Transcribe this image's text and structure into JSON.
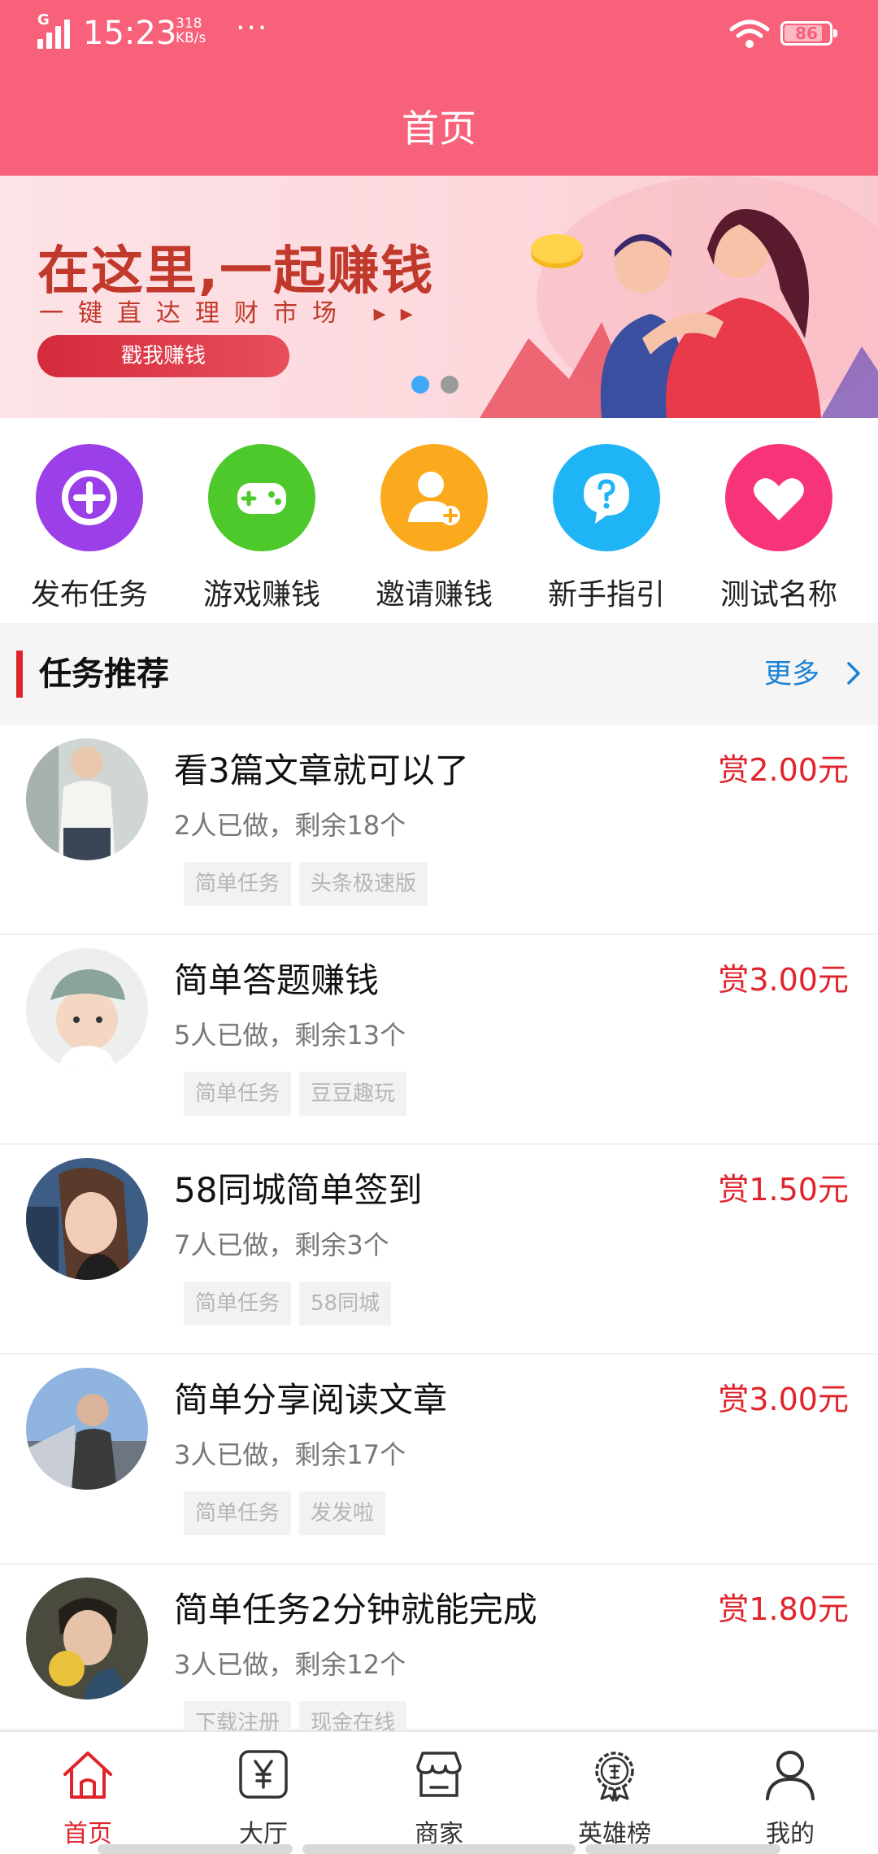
{
  "status_bar": {
    "network": "G",
    "time": "15:23",
    "speed_value": "318",
    "speed_unit": "KB/s",
    "more": "···",
    "battery": "86"
  },
  "header": {
    "title": "首页"
  },
  "banner": {
    "headline": "在这里,一起赚钱",
    "subline": "一键直达理财市场 ▸▸",
    "button": "戳我赚钱",
    "active_dot": 0,
    "dot_count": 2,
    "colors": {
      "active_dot": "#3fa9f5",
      "inactive_dot": "#9b9b9b"
    }
  },
  "quick_menu": [
    {
      "label": "发布任务",
      "icon": "plus-icon",
      "color": "#9b3fe8"
    },
    {
      "label": "游戏赚钱",
      "icon": "gamepad-icon",
      "color": "#4ec92b"
    },
    {
      "label": "邀请赚钱",
      "icon": "add-person-icon",
      "color": "#fbaa1e"
    },
    {
      "label": "新手指引",
      "icon": "question-chat-icon",
      "color": "#1fb4f5"
    },
    {
      "label": "测试名称",
      "icon": "heart-icon",
      "color": "#f7347a"
    }
  ],
  "section": {
    "title": "任务推荐",
    "more": "更多"
  },
  "tasks": [
    {
      "title": "看3篇文章就可以了",
      "reward": "赏2.00元",
      "stats": "2人已做，剩余18个",
      "tags": [
        "简单任务",
        "头条极速版"
      ]
    },
    {
      "title": "简单答题赚钱",
      "reward": "赏3.00元",
      "stats": "5人已做，剩余13个",
      "tags": [
        "简单任务",
        "豆豆趣玩"
      ]
    },
    {
      "title": "58同城简单签到",
      "reward": "赏1.50元",
      "stats": "7人已做，剩余3个",
      "tags": [
        "简单任务",
        "58同城"
      ]
    },
    {
      "title": "简单分享阅读文章",
      "reward": "赏3.00元",
      "stats": "3人已做，剩余17个",
      "tags": [
        "简单任务",
        "发发啦"
      ]
    },
    {
      "title": "简单任务2分钟就能完成",
      "reward": "赏1.80元",
      "stats": "3人已做，剩余12个",
      "tags": [
        "下载注册",
        "现金在线"
      ]
    }
  ],
  "tab_bar": [
    {
      "label": "首页",
      "icon": "home-icon",
      "active": true
    },
    {
      "label": "大厅",
      "icon": "yen-box-icon",
      "active": false
    },
    {
      "label": "商家",
      "icon": "store-icon",
      "active": false
    },
    {
      "label": "英雄榜",
      "icon": "ranking-badge-icon",
      "active": false
    },
    {
      "label": "我的",
      "icon": "person-icon",
      "active": false
    }
  ],
  "theme": {
    "primary": "#f7617a",
    "accent_red": "#e0242b",
    "link_blue": "#1a82d6"
  }
}
